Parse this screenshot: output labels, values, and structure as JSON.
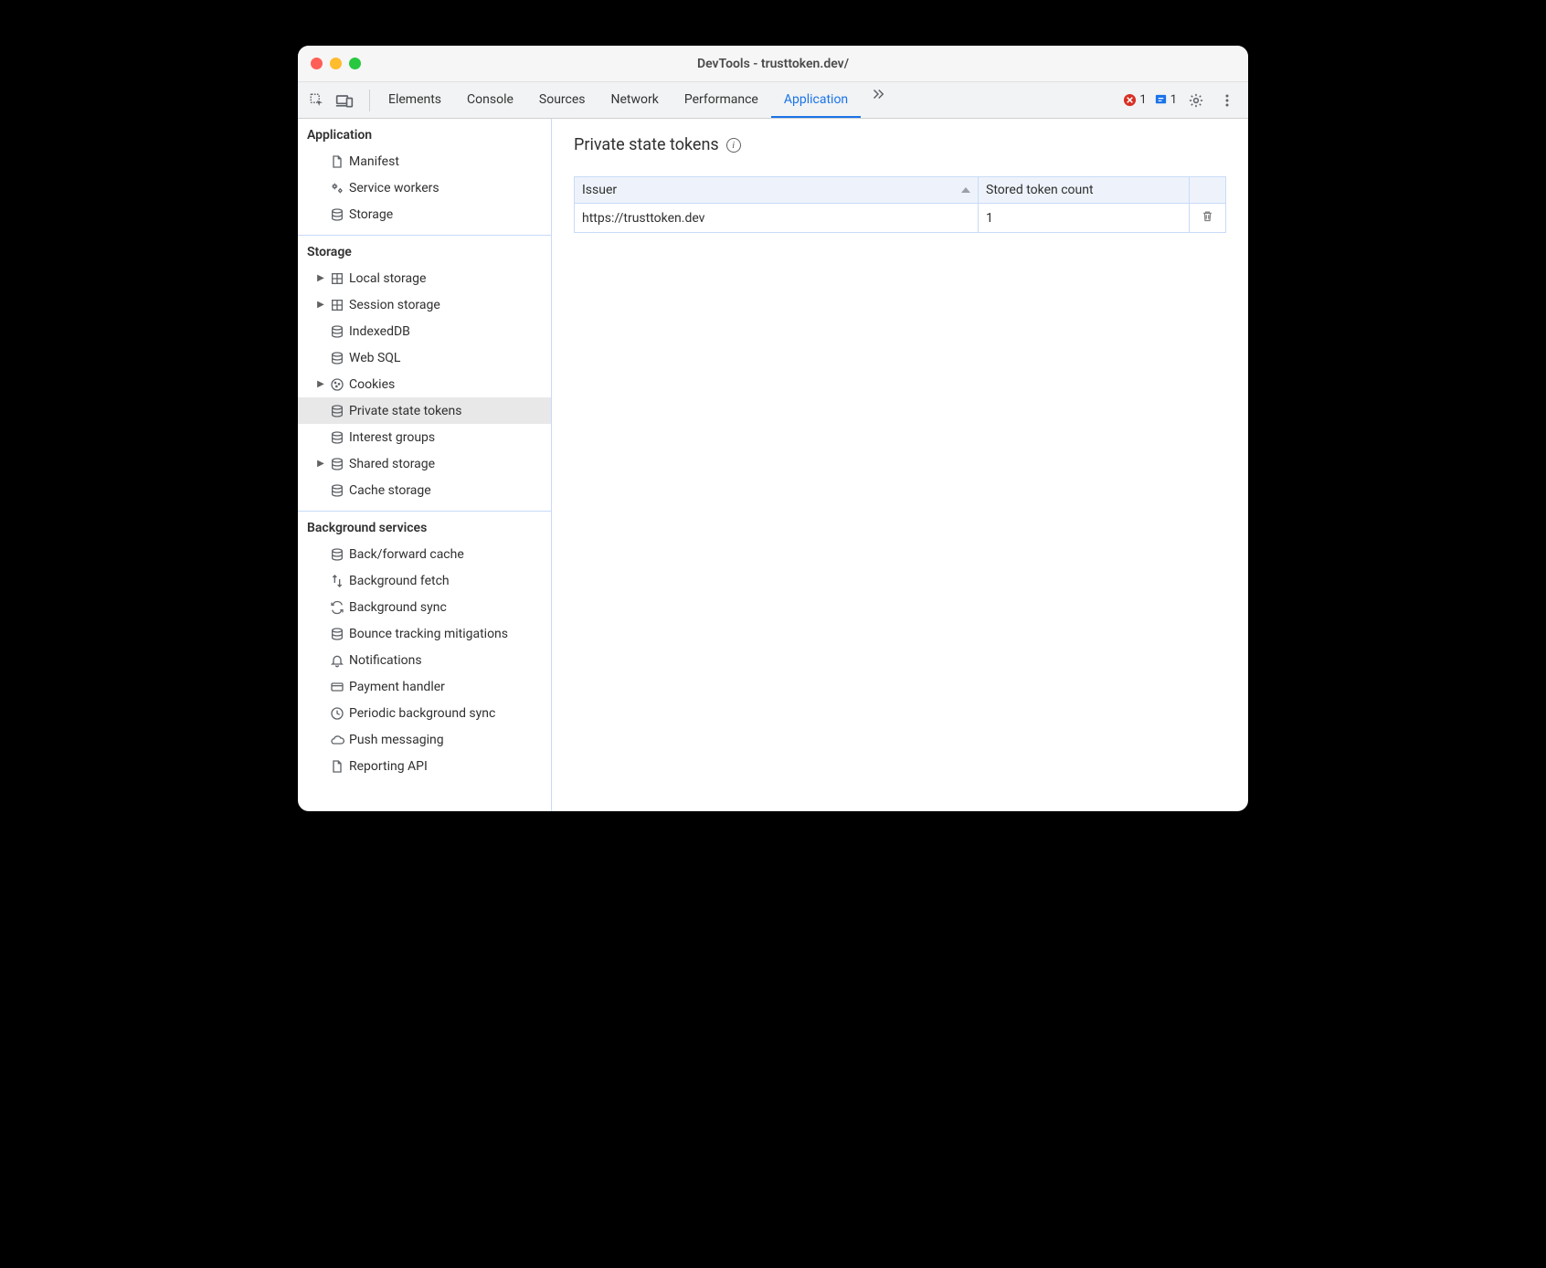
{
  "window": {
    "title": "DevTools - trusttoken.dev/"
  },
  "toolbar": {
    "tabs": [
      "Elements",
      "Console",
      "Sources",
      "Network",
      "Performance",
      "Application"
    ],
    "active_tab": "Application",
    "error_count": "1",
    "issue_count": "1"
  },
  "sidebar": {
    "application": {
      "header": "Application",
      "items": [
        {
          "icon": "file",
          "label": "Manifest",
          "expandable": false
        },
        {
          "icon": "gears",
          "label": "Service workers",
          "expandable": false
        },
        {
          "icon": "db",
          "label": "Storage",
          "expandable": false
        }
      ]
    },
    "storage": {
      "header": "Storage",
      "items": [
        {
          "icon": "grid",
          "label": "Local storage",
          "expandable": true
        },
        {
          "icon": "grid",
          "label": "Session storage",
          "expandable": true
        },
        {
          "icon": "db",
          "label": "IndexedDB",
          "expandable": false
        },
        {
          "icon": "db",
          "label": "Web SQL",
          "expandable": false
        },
        {
          "icon": "cookie",
          "label": "Cookies",
          "expandable": true
        },
        {
          "icon": "db",
          "label": "Private state tokens",
          "expandable": false,
          "selected": true
        },
        {
          "icon": "db",
          "label": "Interest groups",
          "expandable": false
        },
        {
          "icon": "db",
          "label": "Shared storage",
          "expandable": true
        },
        {
          "icon": "db",
          "label": "Cache storage",
          "expandable": false
        }
      ]
    },
    "background": {
      "header": "Background services",
      "items": [
        {
          "icon": "db",
          "label": "Back/forward cache",
          "expandable": false
        },
        {
          "icon": "arrows",
          "label": "Background fetch",
          "expandable": false
        },
        {
          "icon": "sync",
          "label": "Background sync",
          "expandable": false
        },
        {
          "icon": "db",
          "label": "Bounce tracking mitigations",
          "expandable": false
        },
        {
          "icon": "bell",
          "label": "Notifications",
          "expandable": false
        },
        {
          "icon": "card",
          "label": "Payment handler",
          "expandable": false
        },
        {
          "icon": "clock",
          "label": "Periodic background sync",
          "expandable": false
        },
        {
          "icon": "cloud",
          "label": "Push messaging",
          "expandable": false
        },
        {
          "icon": "file",
          "label": "Reporting API",
          "expandable": false
        }
      ]
    }
  },
  "main": {
    "title": "Private state tokens",
    "columns": [
      "Issuer",
      "Stored token count"
    ],
    "rows": [
      {
        "issuer": "https://trusttoken.dev",
        "count": "1"
      }
    ]
  }
}
